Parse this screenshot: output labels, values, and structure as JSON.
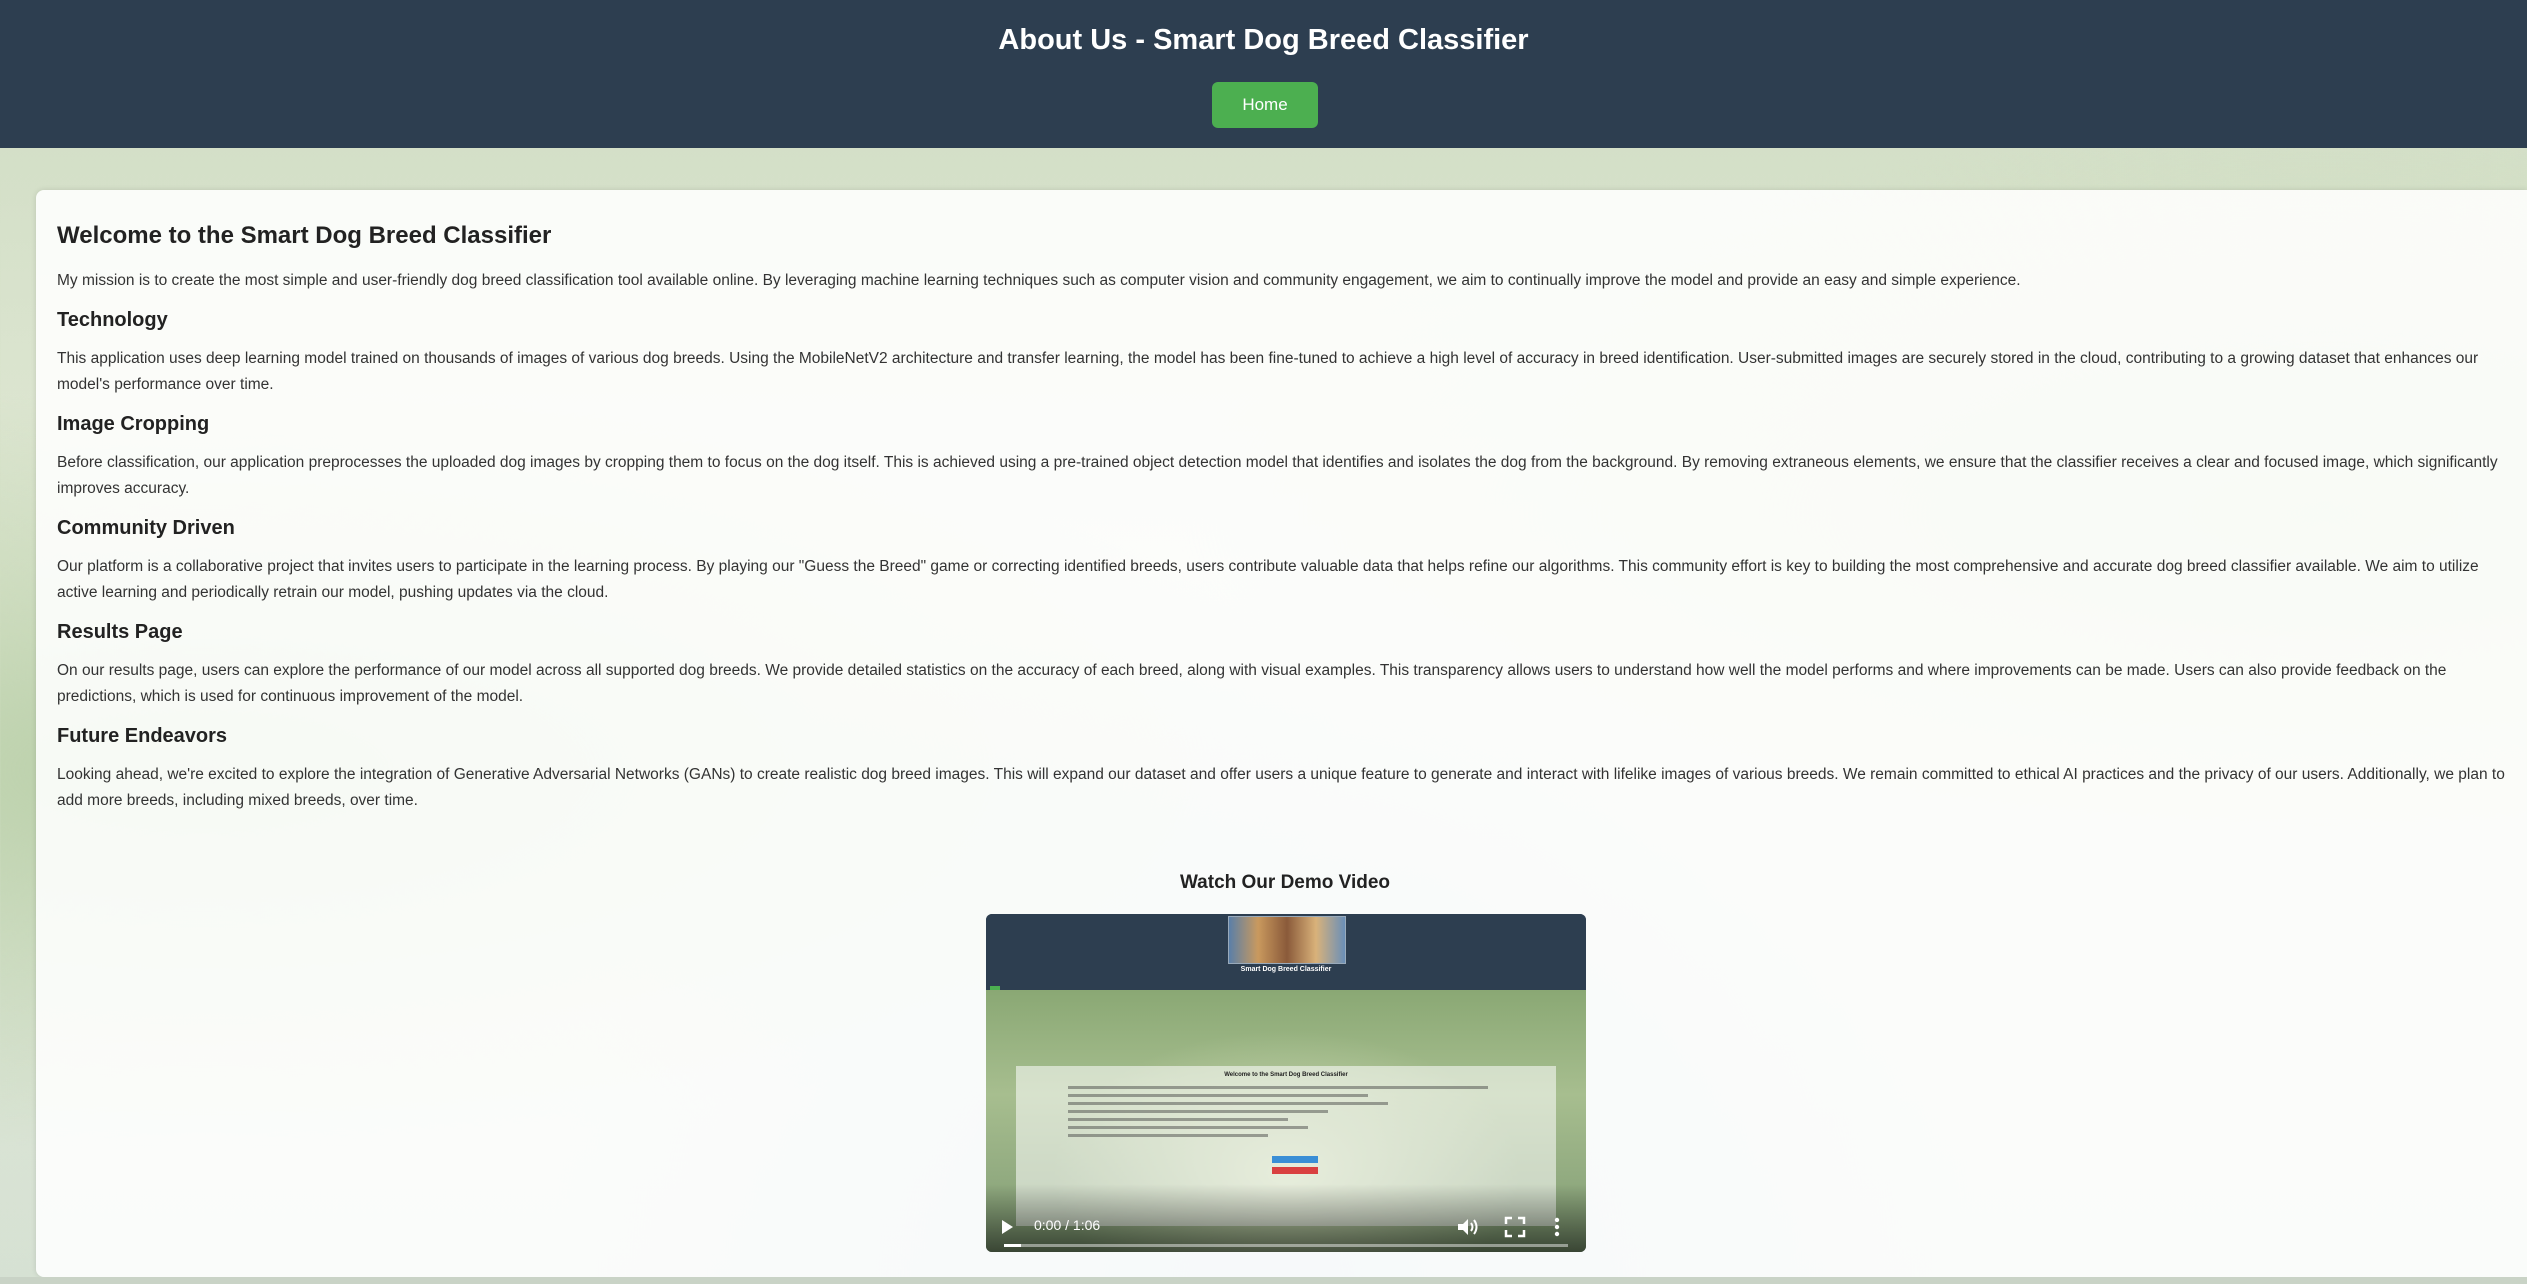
{
  "header": {
    "title": "About Us - Smart Dog Breed Classifier",
    "home_button": "Home"
  },
  "main": {
    "welcome_heading": "Welcome to the Smart Dog Breed Classifier",
    "mission": "My mission is to create the most simple and user-friendly dog breed classification tool available online. By leveraging machine learning techniques such as computer vision and community engagement, we aim to continually improve the model and provide an easy and simple experience.",
    "sections": [
      {
        "heading": "Technology",
        "text": "This application uses deep learning model trained on thousands of images of various dog breeds. Using the MobileNetV2 architecture and transfer learning, the model has been fine-tuned to achieve a high level of accuracy in breed identification. User-submitted images are securely stored in the cloud, contributing to a growing dataset that enhances our model's performance over time."
      },
      {
        "heading": "Image Cropping",
        "text": "Before classification, our application preprocesses the uploaded dog images by cropping them to focus on the dog itself. This is achieved using a pre-trained object detection model that identifies and isolates the dog from the background. By removing extraneous elements, we ensure that the classifier receives a clear and focused image, which significantly improves accuracy."
      },
      {
        "heading": "Community Driven",
        "text": "Our platform is a collaborative project that invites users to participate in the learning process. By playing our \"Guess the Breed\" game or correcting identified breeds, users contribute valuable data that helps refine our algorithms. This community effort is key to building the most comprehensive and accurate dog breed classifier available. We aim to utilize active learning and periodically retrain our model, pushing updates via the cloud."
      },
      {
        "heading": "Results Page",
        "text": "On our results page, users can explore the performance of our model across all supported dog breeds. We provide detailed statistics on the accuracy of each breed, along with visual examples. This transparency allows users to understand how well the model performs and where improvements can be made. Users can also provide feedback on the predictions, which is used for continuous improvement of the model."
      },
      {
        "heading": "Future Endeavors",
        "text": "Looking ahead, we're excited to explore the integration of Generative Adversarial Networks (GANs) to create realistic dog breed images. This will expand our dataset and offer users a unique feature to generate and interact with lifelike images of various breeds. We remain committed to ethical AI practices and the privacy of our users. Additionally, we plan to add more breeds, including mixed breeds, over time."
      }
    ]
  },
  "video": {
    "heading": "Watch Our Demo Video",
    "time": "0:00 / 1:06",
    "progress": 0.03,
    "preview": {
      "app_name": "Smart Dog Breed Classifier",
      "card_title": "Welcome to the Smart Dog Breed Classifier"
    },
    "icons": [
      "play-icon",
      "volume-icon",
      "fullscreen-icon",
      "more-options-icon"
    ]
  },
  "colors": {
    "header_bg": "#2d3e50",
    "home_button_bg": "#4caf50",
    "panel_bg": "#ffffff"
  }
}
